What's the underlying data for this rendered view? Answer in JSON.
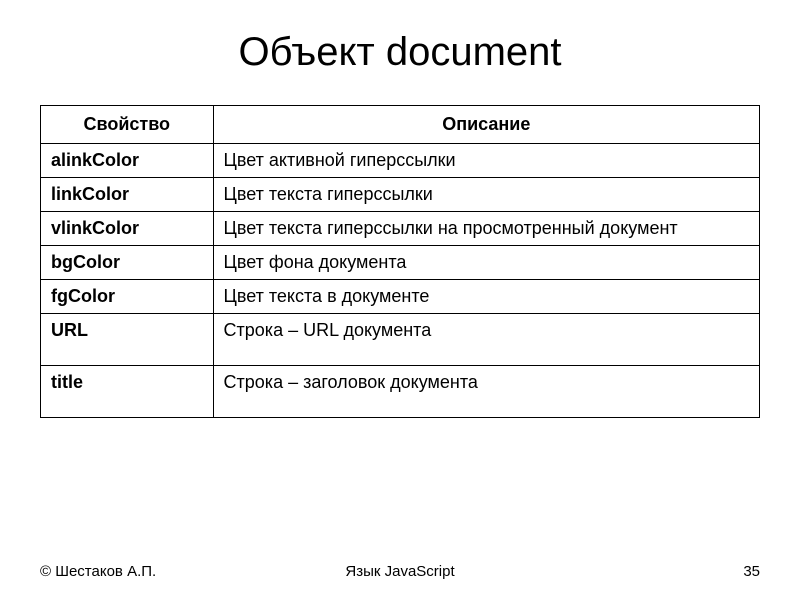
{
  "title": "Объект document",
  "table": {
    "headers": {
      "property": "Свойство",
      "description": "Описание"
    },
    "rows": [
      {
        "property": "alinkColor",
        "description": "Цвет активной гиперссылки"
      },
      {
        "property": "linkColor",
        "description": "Цвет текста гиперссылки"
      },
      {
        "property": "vlinkColor",
        "description": "Цвет текста гиперссылки на просмотренный документ"
      },
      {
        "property": "bgColor",
        "description": "Цвет фона документа"
      },
      {
        "property": "fgColor",
        "description": "Цвет текста в документе"
      },
      {
        "property": "URL",
        "description": "Строка – URL документа"
      },
      {
        "property": "title",
        "description": "Строка – заголовок документа"
      }
    ]
  },
  "footer": {
    "author": "© Шестаков А.П.",
    "subject": "Язык JavaScript",
    "page": "35"
  }
}
